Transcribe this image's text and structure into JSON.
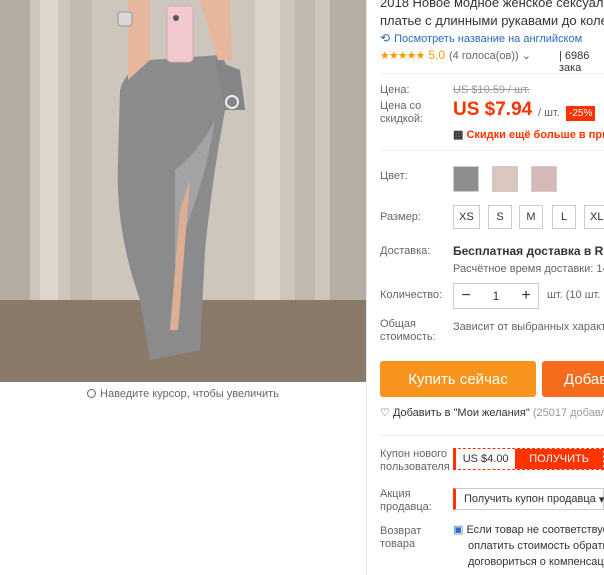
{
  "product": {
    "title_line1": "2018 Новое модное женское сексуальное",
    "title_line2": "платье с длинными рукавами до колен",
    "translate_link": "Посмотреть название на английском",
    "stars": "★★★★★",
    "rating": "5.0",
    "votes": "(4 голоса(ов))",
    "orders": "6986 зака"
  },
  "gallery": {
    "zoom_hint": "Наведите курсор, чтобы увеличить"
  },
  "price": {
    "label": "Цена:",
    "old": "US $10.59 / шт.",
    "discount_label_1": "Цена со",
    "discount_label_2": "скидкой:",
    "current": "US $7.94",
    "unit": "/ шт.",
    "discount": "-25%",
    "coupon_link": "Скидки ещё больше в прил"
  },
  "options": {
    "color_label": "Цвет:",
    "colors": [
      "#8e8e8e",
      "#d9c7bd",
      "#d7b8b8"
    ],
    "size_label": "Размер:",
    "sizes": [
      "XS",
      "S",
      "M",
      "L",
      "XL"
    ]
  },
  "shipping": {
    "label": "Доставка:",
    "main": "Бесплатная доставка в Russia",
    "sub": "Расчётное время доставки: 14"
  },
  "quantity": {
    "label": "Количество:",
    "minus": "−",
    "value": "1",
    "plus": "+",
    "unit": "шт. (10 шт. -"
  },
  "total": {
    "label_1": "Общая",
    "label_2": "стоимость:",
    "value": "Зависит от выбранных характе"
  },
  "actions": {
    "buy_now": "Купить сейчас",
    "add_to_cart": "Добав",
    "wishlist": "Добавить в \"Мои желания\"",
    "wishlist_count": "(25017 добавле"
  },
  "coupon": {
    "label_1": "Купон нового",
    "label_2": "пользователя",
    "value": "US $4.00",
    "get": "ПОЛУЧИТЬ"
  },
  "promo": {
    "label_1": "Акция",
    "label_2": "продавца:",
    "text": "Получить купон продавца"
  },
  "returns": {
    "label_1": "Возврат",
    "label_2": "товара",
    "line1": "Если товар не соответствуе",
    "line2": "оплатить стоимость обратн",
    "line3": "договориться о компенсац"
  },
  "colors": {
    "accent": "#ff3300",
    "buy": "#f7941d",
    "cart": "#f46b1b",
    "link": "#2a6dbb",
    "star": "#ff9900"
  }
}
